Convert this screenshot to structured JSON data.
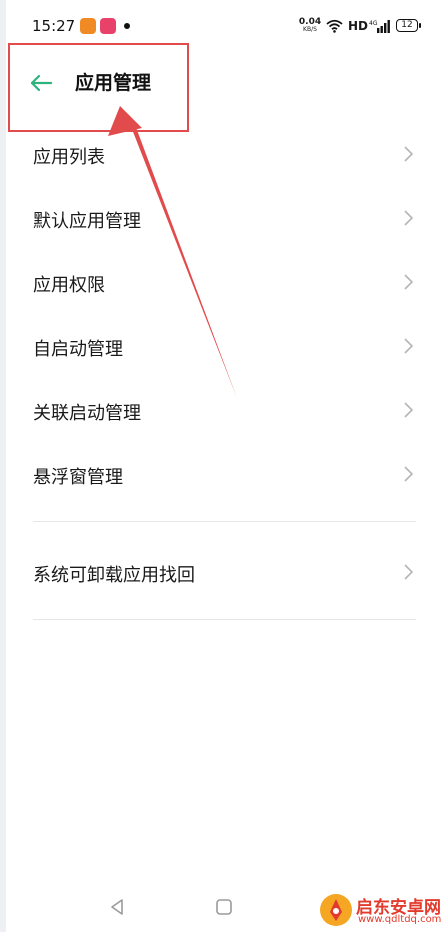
{
  "status_bar": {
    "time": "15:27",
    "net_speed_value": "0.04",
    "net_speed_unit": "KB/S",
    "hd_label": "HD",
    "battery_level": "12",
    "icons": [
      "app-notification-icon",
      "app-notification-icon",
      "notification-dot-icon",
      "wifi-icon",
      "signal-4g-icon",
      "battery-icon"
    ]
  },
  "header": {
    "title": "应用管理",
    "back_icon": "back-arrow-icon"
  },
  "menu": {
    "items": [
      {
        "label": "应用列表"
      },
      {
        "label": "默认应用管理"
      },
      {
        "label": "应用权限"
      },
      {
        "label": "自启动管理"
      },
      {
        "label": "关联启动管理"
      },
      {
        "label": "悬浮窗管理"
      }
    ],
    "restore_item": {
      "label": "系统可卸载应用找回"
    },
    "chevron_icon": "chevron-right-icon"
  },
  "nav_bar": {
    "icons": [
      "nav-back-icon",
      "nav-home-icon"
    ]
  },
  "watermark": {
    "name": "启东安卓网",
    "url": "www.qdltdq.com"
  },
  "colors": {
    "accent": "#2fb37e",
    "annotation": "#e24b4b",
    "watermark": "#e23b2d"
  }
}
